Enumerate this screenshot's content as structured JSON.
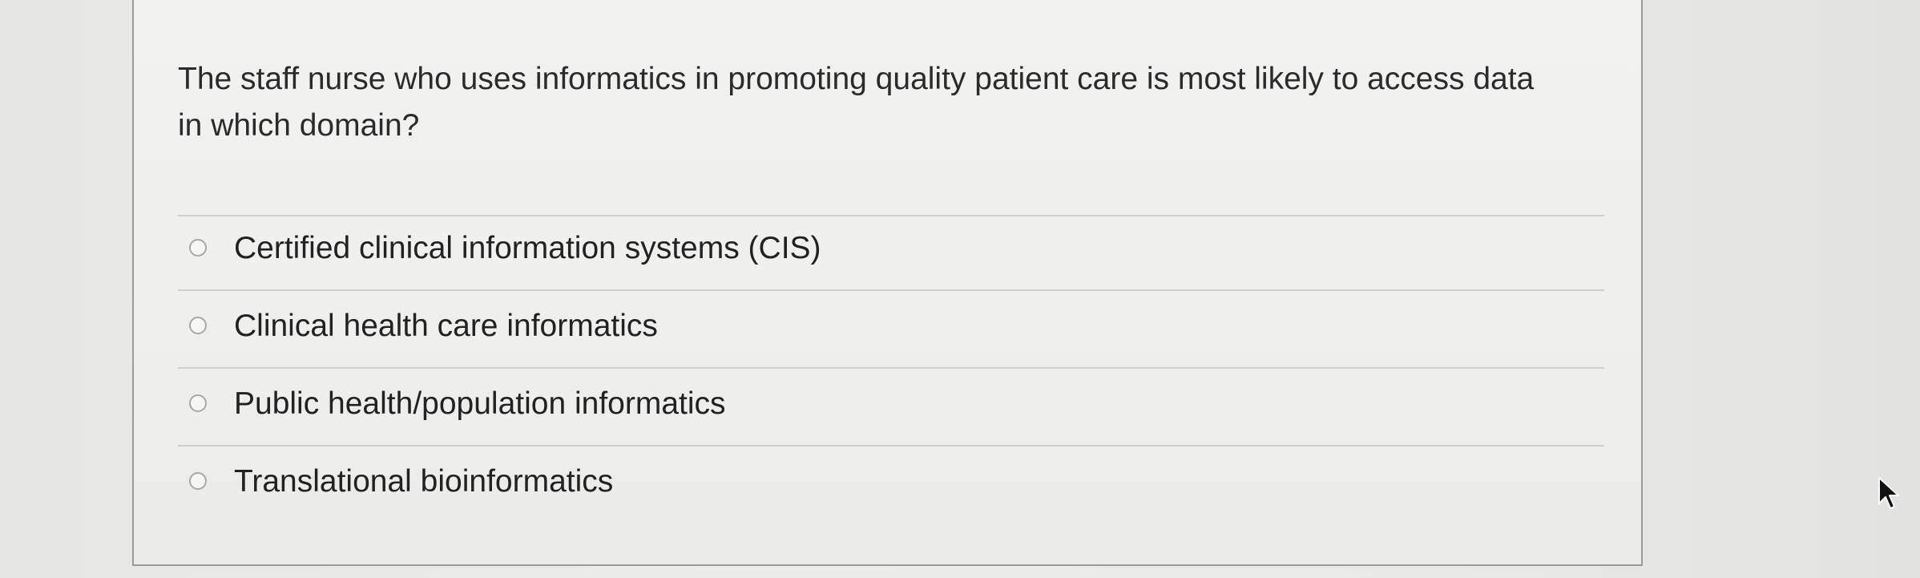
{
  "question": {
    "text": "The staff nurse who uses informatics in promoting quality patient care is most likely to access data in which domain?"
  },
  "options": [
    {
      "label": "Certified clinical information systems (CIS)",
      "selected": false
    },
    {
      "label": "Clinical health care informatics",
      "selected": false
    },
    {
      "label": "Public health/population informatics",
      "selected": false
    },
    {
      "label": "Translational bioinformatics",
      "selected": false
    }
  ],
  "icons": {
    "cursor": "mouse-pointer-icon",
    "radio": "radio-button-icon"
  },
  "colors": {
    "card_border": "#9a9a98",
    "text": "#2b2b2b",
    "divider": "#cdcdcb"
  }
}
